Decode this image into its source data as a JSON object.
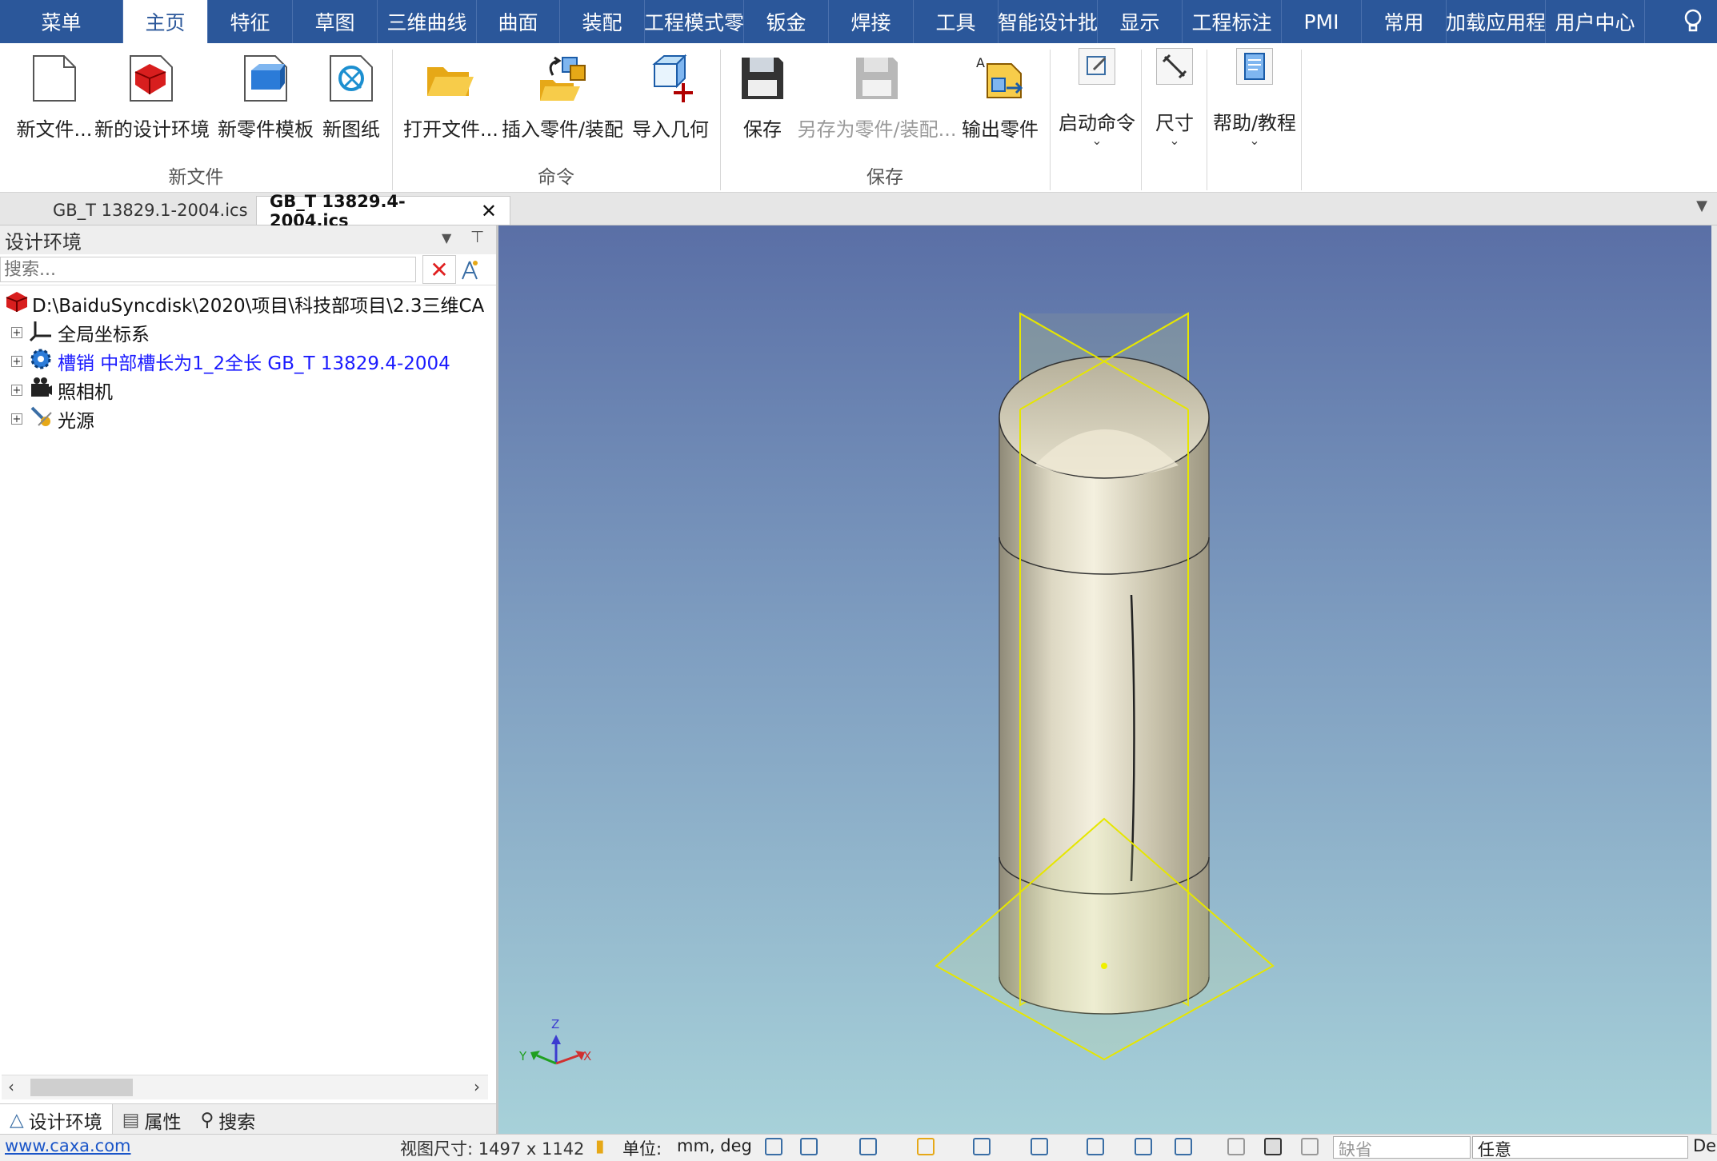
{
  "ribbon_tabs": [
    "菜单",
    "主页",
    "特征",
    "草图",
    "三维曲线",
    "曲面",
    "装配",
    "工程模式零",
    "钣金",
    "焊接",
    "工具",
    "智能设计批",
    "显示",
    "工程标注",
    "PMI",
    "常用",
    "加载应用程",
    "用户中心"
  ],
  "active_tab": "主页",
  "ribbon": {
    "new_file": "新文件...",
    "new_design_env": "新的设计环境",
    "new_part_template": "新零件模板",
    "new_drawing": "新图纸",
    "open_file": "打开文件...",
    "insert_part": "插入零件/装配",
    "import_geometry": "导入几何",
    "save": "保存",
    "save_as_part": "另存为零件/装配...",
    "export_part": "输出零件",
    "start_command": "启动命令",
    "dimension": "尺寸",
    "help": "帮助/教程",
    "group_new_file": "新文件",
    "group_command": "命令",
    "group_save": "保存"
  },
  "doc_tabs": [
    {
      "label": "GB_T 13829.1-2004.ics",
      "active": false
    },
    {
      "label": "GB_T 13829.4-2004.ics",
      "active": true
    }
  ],
  "panel": {
    "title": "设计环境",
    "search_placeholder": "搜索...",
    "tree_root": "D:\\BaiduSyncdisk\\2020\\项目\\科技部项目\\2.3三维CA",
    "tree_items": [
      "全局坐标系",
      "槽销 中部槽长为1_2全长 GB_T 13829.4-2004",
      "照相机",
      "光源"
    ],
    "bottom_tabs": [
      "设计环境",
      "属性",
      "搜索"
    ]
  },
  "axes": {
    "z": "Z",
    "y": "Y",
    "x": "X"
  },
  "status": {
    "website": "www.caxa.com",
    "view_size": "视图尺寸: 1497 x 1142",
    "units_label": "单位:",
    "units_value": "mm, deg",
    "combo_default": "缺省",
    "combo_any": "任意",
    "trailing": "De"
  },
  "colors": {
    "ribbon_blue": "#2b579a",
    "tree_link": "#1a1aff",
    "plane_yellow": "#e6e600"
  }
}
